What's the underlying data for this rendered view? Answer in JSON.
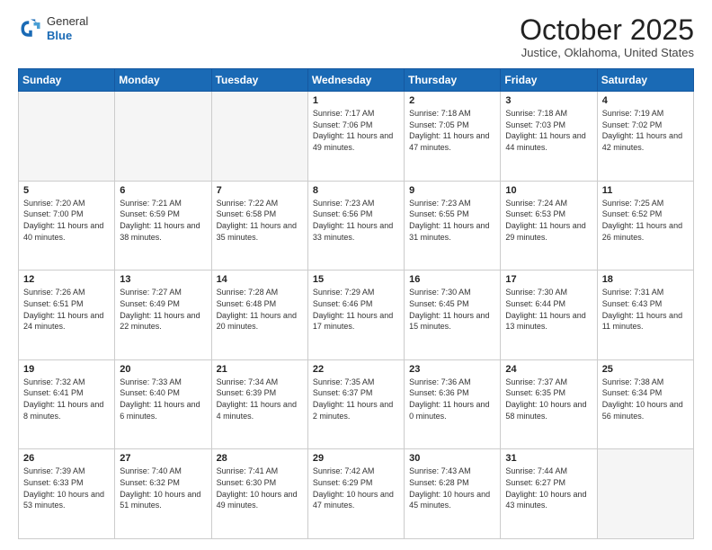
{
  "header": {
    "logo": {
      "general": "General",
      "blue": "Blue"
    },
    "title": "October 2025",
    "location": "Justice, Oklahoma, United States"
  },
  "weekdays": [
    "Sunday",
    "Monday",
    "Tuesday",
    "Wednesday",
    "Thursday",
    "Friday",
    "Saturday"
  ],
  "weeks": [
    [
      {
        "day": "",
        "empty": true
      },
      {
        "day": "",
        "empty": true
      },
      {
        "day": "",
        "empty": true
      },
      {
        "day": "1",
        "sunrise": "7:17 AM",
        "sunset": "7:06 PM",
        "daylight": "11 hours and 49 minutes."
      },
      {
        "day": "2",
        "sunrise": "7:18 AM",
        "sunset": "7:05 PM",
        "daylight": "11 hours and 47 minutes."
      },
      {
        "day": "3",
        "sunrise": "7:18 AM",
        "sunset": "7:03 PM",
        "daylight": "11 hours and 44 minutes."
      },
      {
        "day": "4",
        "sunrise": "7:19 AM",
        "sunset": "7:02 PM",
        "daylight": "11 hours and 42 minutes."
      }
    ],
    [
      {
        "day": "5",
        "sunrise": "7:20 AM",
        "sunset": "7:00 PM",
        "daylight": "11 hours and 40 minutes."
      },
      {
        "day": "6",
        "sunrise": "7:21 AM",
        "sunset": "6:59 PM",
        "daylight": "11 hours and 38 minutes."
      },
      {
        "day": "7",
        "sunrise": "7:22 AM",
        "sunset": "6:58 PM",
        "daylight": "11 hours and 35 minutes."
      },
      {
        "day": "8",
        "sunrise": "7:23 AM",
        "sunset": "6:56 PM",
        "daylight": "11 hours and 33 minutes."
      },
      {
        "day": "9",
        "sunrise": "7:23 AM",
        "sunset": "6:55 PM",
        "daylight": "11 hours and 31 minutes."
      },
      {
        "day": "10",
        "sunrise": "7:24 AM",
        "sunset": "6:53 PM",
        "daylight": "11 hours and 29 minutes."
      },
      {
        "day": "11",
        "sunrise": "7:25 AM",
        "sunset": "6:52 PM",
        "daylight": "11 hours and 26 minutes."
      }
    ],
    [
      {
        "day": "12",
        "sunrise": "7:26 AM",
        "sunset": "6:51 PM",
        "daylight": "11 hours and 24 minutes."
      },
      {
        "day": "13",
        "sunrise": "7:27 AM",
        "sunset": "6:49 PM",
        "daylight": "11 hours and 22 minutes."
      },
      {
        "day": "14",
        "sunrise": "7:28 AM",
        "sunset": "6:48 PM",
        "daylight": "11 hours and 20 minutes."
      },
      {
        "day": "15",
        "sunrise": "7:29 AM",
        "sunset": "6:46 PM",
        "daylight": "11 hours and 17 minutes."
      },
      {
        "day": "16",
        "sunrise": "7:30 AM",
        "sunset": "6:45 PM",
        "daylight": "11 hours and 15 minutes."
      },
      {
        "day": "17",
        "sunrise": "7:30 AM",
        "sunset": "6:44 PM",
        "daylight": "11 hours and 13 minutes."
      },
      {
        "day": "18",
        "sunrise": "7:31 AM",
        "sunset": "6:43 PM",
        "daylight": "11 hours and 11 minutes."
      }
    ],
    [
      {
        "day": "19",
        "sunrise": "7:32 AM",
        "sunset": "6:41 PM",
        "daylight": "11 hours and 8 minutes."
      },
      {
        "day": "20",
        "sunrise": "7:33 AM",
        "sunset": "6:40 PM",
        "daylight": "11 hours and 6 minutes."
      },
      {
        "day": "21",
        "sunrise": "7:34 AM",
        "sunset": "6:39 PM",
        "daylight": "11 hours and 4 minutes."
      },
      {
        "day": "22",
        "sunrise": "7:35 AM",
        "sunset": "6:37 PM",
        "daylight": "11 hours and 2 minutes."
      },
      {
        "day": "23",
        "sunrise": "7:36 AM",
        "sunset": "6:36 PM",
        "daylight": "11 hours and 0 minutes."
      },
      {
        "day": "24",
        "sunrise": "7:37 AM",
        "sunset": "6:35 PM",
        "daylight": "10 hours and 58 minutes."
      },
      {
        "day": "25",
        "sunrise": "7:38 AM",
        "sunset": "6:34 PM",
        "daylight": "10 hours and 56 minutes."
      }
    ],
    [
      {
        "day": "26",
        "sunrise": "7:39 AM",
        "sunset": "6:33 PM",
        "daylight": "10 hours and 53 minutes."
      },
      {
        "day": "27",
        "sunrise": "7:40 AM",
        "sunset": "6:32 PM",
        "daylight": "10 hours and 51 minutes."
      },
      {
        "day": "28",
        "sunrise": "7:41 AM",
        "sunset": "6:30 PM",
        "daylight": "10 hours and 49 minutes."
      },
      {
        "day": "29",
        "sunrise": "7:42 AM",
        "sunset": "6:29 PM",
        "daylight": "10 hours and 47 minutes."
      },
      {
        "day": "30",
        "sunrise": "7:43 AM",
        "sunset": "6:28 PM",
        "daylight": "10 hours and 45 minutes."
      },
      {
        "day": "31",
        "sunrise": "7:44 AM",
        "sunset": "6:27 PM",
        "daylight": "10 hours and 43 minutes."
      },
      {
        "day": "",
        "empty": true
      }
    ]
  ]
}
